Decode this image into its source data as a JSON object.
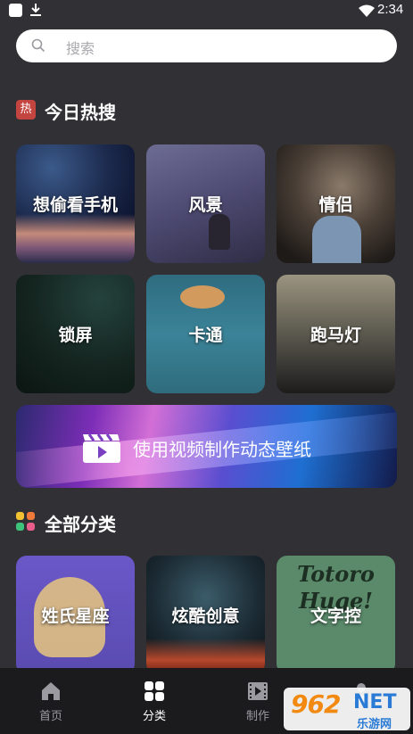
{
  "status_bar": {
    "time": "2:34"
  },
  "search": {
    "placeholder": "搜索"
  },
  "hot_section": {
    "icon_char": "热",
    "title": "今日热搜"
  },
  "hot_tiles": [
    {
      "label": "想偷看手机"
    },
    {
      "label": "风景"
    },
    {
      "label": "情侣"
    },
    {
      "label": "锁屏"
    },
    {
      "label": "卡通"
    },
    {
      "label": "跑马灯"
    }
  ],
  "banner": {
    "label": "使用视频制作动态壁纸"
  },
  "all_section": {
    "title": "全部分类"
  },
  "category_tiles": [
    {
      "label": "姓氏星座"
    },
    {
      "label": "炫酷创意"
    },
    {
      "label": "文字控",
      "decor_text": "Totoro Huge!"
    }
  ],
  "bottom_nav": [
    {
      "label": "首页",
      "icon": "home-icon",
      "active": false
    },
    {
      "label": "分类",
      "icon": "grid-icon",
      "active": true
    },
    {
      "label": "制作",
      "icon": "film-icon",
      "active": false
    },
    {
      "label": "",
      "icon": "user-icon",
      "active": false
    }
  ],
  "watermark": {
    "number": "962",
    "domain": "NET",
    "sub": "乐游网"
  },
  "colors": {
    "background": "#303035",
    "nav_background": "#1b1b1e",
    "nav_inactive": "#9a9aa0",
    "nav_active": "#ffffff",
    "hot_badge": "#c4443f",
    "dot_yellow": "#f2c233",
    "dot_orange": "#f07a3a",
    "dot_green": "#3ec37a",
    "dot_pink": "#e85d8a"
  }
}
